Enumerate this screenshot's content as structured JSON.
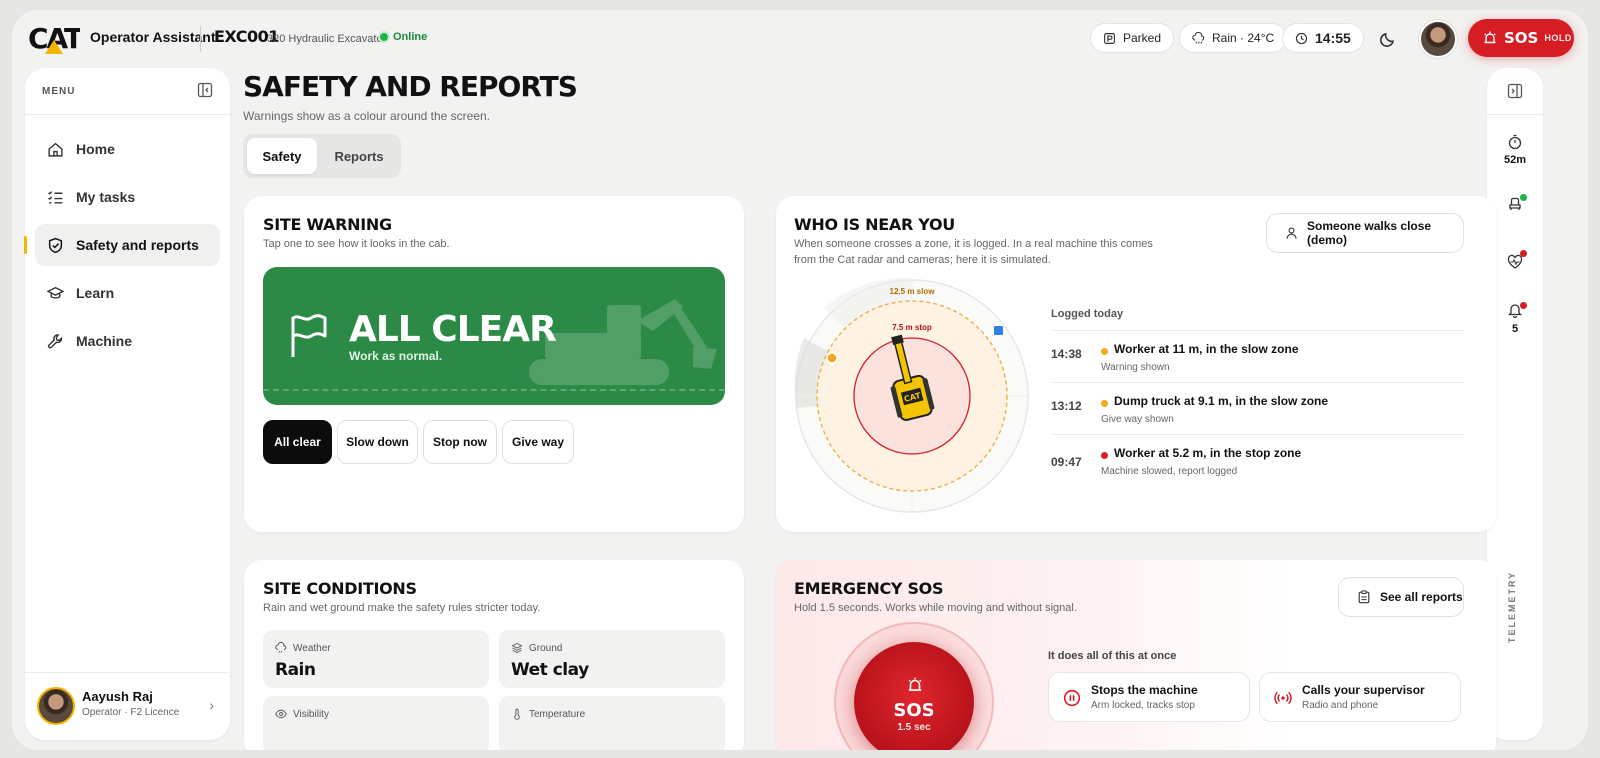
{
  "header": {
    "brand": "CAT",
    "app_name": "Operator Assistant",
    "machine_id": "EXC001",
    "machine_model": "320 Hydraulic Excavator",
    "status": "Online",
    "parked": "Parked",
    "weather": "Rain · 24°C",
    "time": "14:55",
    "sos_label": "SOS",
    "sos_hint": "HOLD"
  },
  "sidebar": {
    "menu_label": "MENU",
    "items": [
      {
        "label": "Home",
        "icon": "home-icon"
      },
      {
        "label": "My tasks",
        "icon": "tasks-icon"
      },
      {
        "label": "Safety and reports",
        "icon": "shield-icon",
        "active": true
      },
      {
        "label": "Learn",
        "icon": "graduation-cap-icon"
      },
      {
        "label": "Machine",
        "icon": "wrench-icon"
      }
    ],
    "user": {
      "name": "Aayush Raj",
      "role": "Operator · F2 Licence"
    }
  },
  "rail": {
    "timer_value": "52m",
    "alerts_count": "5",
    "label": "TELEMETRY"
  },
  "page": {
    "title": "SAFETY AND REPORTS",
    "subtitle": "Warnings show as a colour around the screen.",
    "tabs": [
      "Safety",
      "Reports"
    ],
    "active_tab": "Safety"
  },
  "site_warning": {
    "title": "SITE WARNING",
    "subtitle": "Tap one to see how it looks in the cab.",
    "banner_title": "ALL CLEAR",
    "banner_sub": "Work as normal.",
    "banner_color": "#2b8a45",
    "options": [
      "All clear",
      "Slow down",
      "Stop now",
      "Give way"
    ],
    "selected": "All clear"
  },
  "near_you": {
    "title": "WHO IS NEAR YOU",
    "subtitle_1": "When someone crosses a zone, it is logged. In a real machine this comes",
    "subtitle_2": "from the Cat radar and cameras; here it is simulated.",
    "demo_button": "Someone walks close (demo)",
    "slow_zone_label": "12.5 m slow",
    "stop_zone_label": "7.5 m stop",
    "log_title": "Logged today",
    "log": [
      {
        "time": "14:38",
        "event": "Worker at 11 m, in the slow zone",
        "note": "Warning shown",
        "color": "#f4a81d"
      },
      {
        "time": "13:12",
        "event": "Dump truck at 9.1 m, in the slow zone",
        "note": "Give way shown",
        "color": "#f4a81d"
      },
      {
        "time": "09:47",
        "event": "Worker at 5.2 m, in the stop zone",
        "note": "Machine slowed, report logged",
        "color": "#d61d24"
      }
    ]
  },
  "conditions": {
    "title": "SITE CONDITIONS",
    "subtitle": "Rain and wet ground make the safety rules stricter today.",
    "tiles": [
      {
        "label": "Weather",
        "value": "Rain",
        "icon": "cloud-rain-icon"
      },
      {
        "label": "Ground",
        "value": "Wet clay",
        "icon": "layers-icon"
      },
      {
        "label": "Visibility",
        "value": "",
        "icon": "eye-icon"
      },
      {
        "label": "Temperature",
        "value": "",
        "icon": "thermometer-icon"
      }
    ]
  },
  "emergency": {
    "title": "EMERGENCY SOS",
    "subtitle": "Hold 1.5 seconds. Works while moving and without signal.",
    "reports_button": "See all reports",
    "sos_word": "SOS",
    "sos_secs": "1.5 sec",
    "all_once": "It does all of this at once",
    "actions": [
      {
        "title": "Stops the machine",
        "sub": "Arm locked, tracks stop",
        "icon": "pause-circle-icon"
      },
      {
        "title": "Calls your supervisor",
        "sub": "Radio and phone",
        "icon": "radio-icon"
      }
    ]
  }
}
